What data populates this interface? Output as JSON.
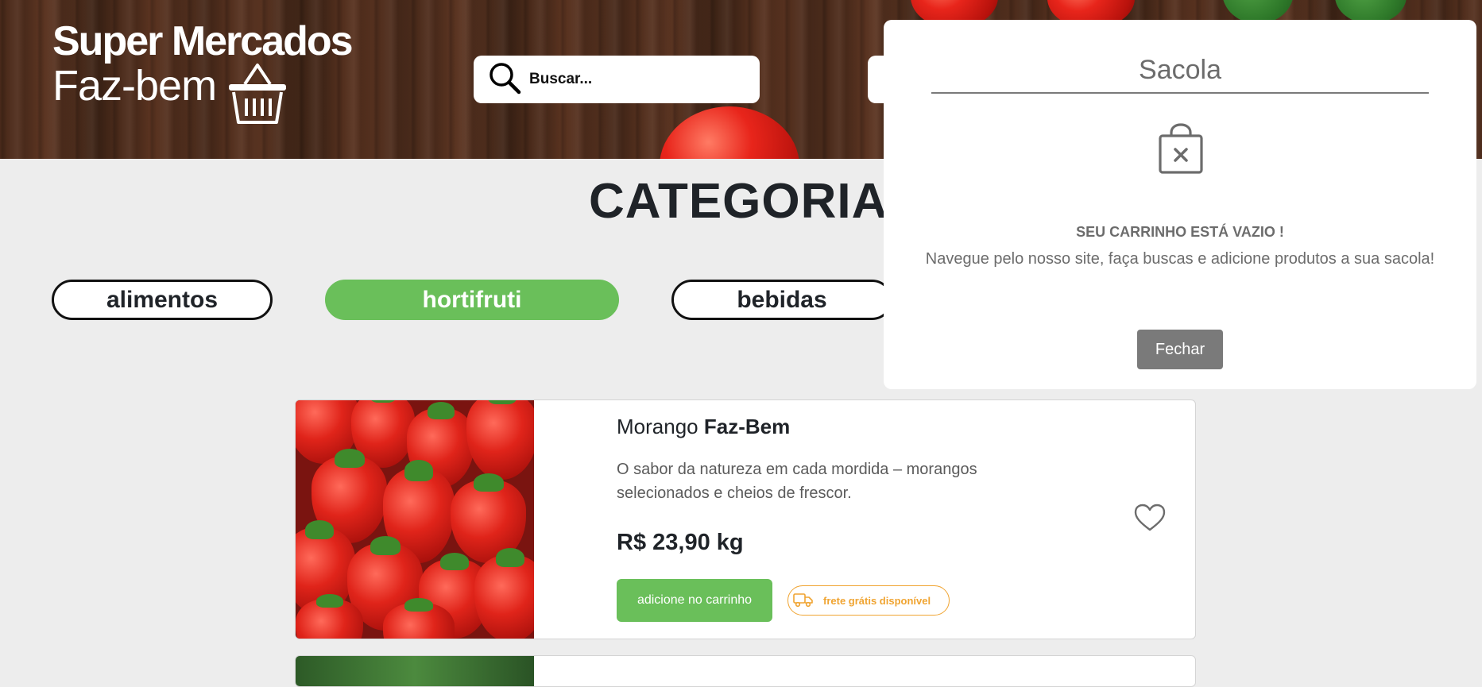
{
  "header": {
    "logo_line1": "Super Mercados",
    "logo_line2": "Faz-bem",
    "search_placeholder": "Buscar..."
  },
  "categories": {
    "title": "CATEGORIAS",
    "items": [
      {
        "label": "alimentos",
        "active": false
      },
      {
        "label": "hortifruti",
        "active": true
      },
      {
        "label": "bebidas",
        "active": false
      }
    ]
  },
  "products": [
    {
      "name_prefix": "Morango",
      "name_brand": "Faz-Bem",
      "description": "O sabor da natureza em cada mordida – morangos selecionados e cheios de frescor.",
      "price": "R$ 23,90 kg",
      "add_label": "adicione no carrinho",
      "shipping_label": "frete grátis disponível"
    }
  ],
  "bag": {
    "title": "Sacola",
    "empty_title": "SEU CARRINHO ESTÁ VAZIO !",
    "empty_text": "Navegue pelo nosso site, faça buscas e adicione produtos a sua sacola!",
    "close_label": "Fechar"
  },
  "colors": {
    "accent_green": "#6abf5a",
    "shipping_orange": "#f0a431",
    "panel_gray": "#7a7a7a"
  },
  "icons": [
    "basket-icon",
    "search-icon",
    "empty-bag-icon",
    "truck-icon",
    "heart-icon"
  ]
}
